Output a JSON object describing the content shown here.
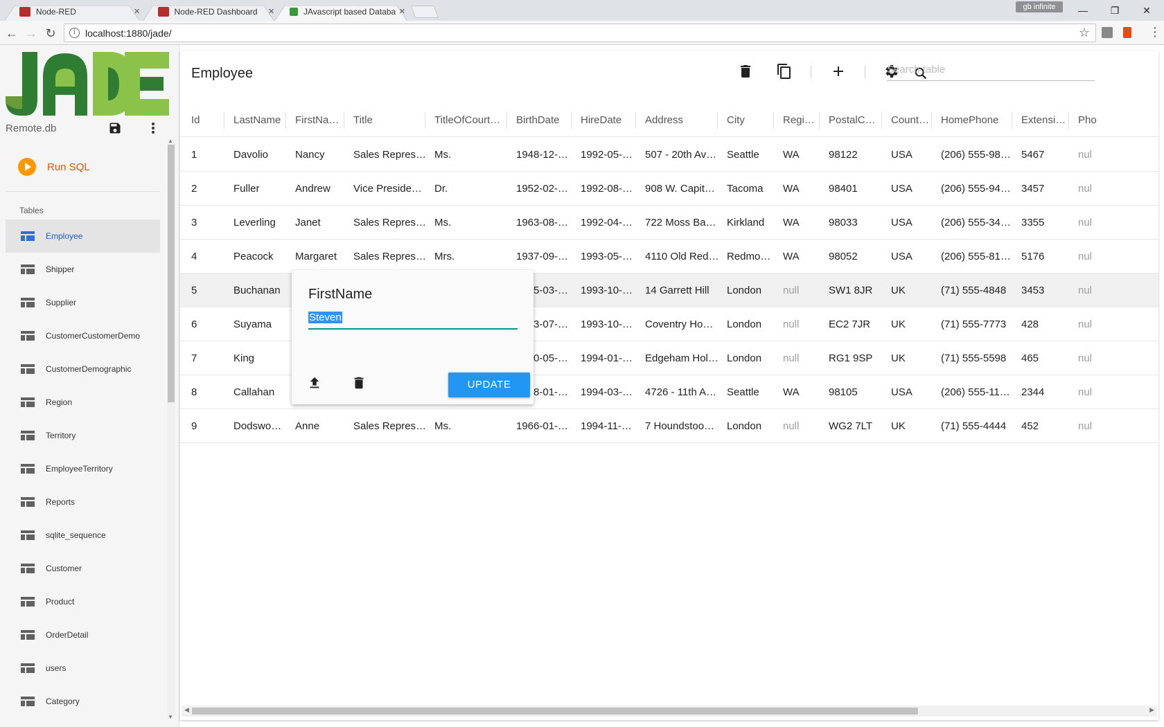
{
  "browser": {
    "tabs": [
      {
        "title": "Node-RED",
        "color": "#b52e2e"
      },
      {
        "title": "Node-RED Dashboard",
        "color": "#b52e2e"
      },
      {
        "title": "JAvascript based Databa",
        "color": "#3a9a3a"
      }
    ],
    "profile": "gb infinite",
    "url": "localhost:1880/jade/",
    "window_controls": {
      "minimize": "—",
      "restore": "❐",
      "close": "✕"
    }
  },
  "sidebar": {
    "db_name": "Remote.db",
    "run_sql": "Run SQL",
    "tables_header": "Tables",
    "tables": [
      "Employee",
      "Shipper",
      "Supplier",
      "CustomerCustomerDemo",
      "CustomerDemographic",
      "Region",
      "Territory",
      "EmployeeTerritory",
      "Reports",
      "sqlite_sequence",
      "Customer",
      "Product",
      "OrderDetail",
      "users",
      "Category"
    ],
    "selected_index": 0
  },
  "main": {
    "table_title": "Employee",
    "search_placeholder": "Search table",
    "columns": [
      "Id",
      "LastName",
      "FirstNa…",
      "Title",
      "TitleOfCourt…",
      "BirthDate",
      "HireDate",
      "Address",
      "City",
      "Regi…",
      "PostalC…",
      "Count…",
      "HomePhone",
      "Extensi…",
      "Pho"
    ],
    "rows": [
      [
        "1",
        "Davolio",
        "Nancy",
        "Sales Repres…",
        "Ms.",
        "1948-12-…",
        "1992-05-…",
        "507 - 20th Av…",
        "Seattle",
        "WA",
        "98122",
        "USA",
        "(206) 555-98…",
        "5467",
        "nul"
      ],
      [
        "2",
        "Fuller",
        "Andrew",
        "Vice Preside…",
        "Dr.",
        "1952-02-…",
        "1992-08-…",
        "908 W. Capit…",
        "Tacoma",
        "WA",
        "98401",
        "USA",
        "(206) 555-94…",
        "3457",
        "nul"
      ],
      [
        "3",
        "Leverling",
        "Janet",
        "Sales Repres…",
        "Ms.",
        "1963-08-…",
        "1992-04-…",
        "722 Moss Ba…",
        "Kirkland",
        "WA",
        "98033",
        "USA",
        "(206) 555-34…",
        "3355",
        "nul"
      ],
      [
        "4",
        "Peacock",
        "Margaret",
        "Sales Repres…",
        "Mrs.",
        "1937-09-…",
        "1993-05-…",
        "4110 Old Red…",
        "Redmo…",
        "WA",
        "98052",
        "USA",
        "(206) 555-81…",
        "5176",
        "nul"
      ],
      [
        "5",
        "Buchanan",
        "",
        "",
        "",
        "1955-03-…",
        "1993-10-…",
        "14 Garrett Hill",
        "London",
        "null",
        "SW1 8JR",
        "UK",
        "(71) 555-4848",
        "3453",
        "nul"
      ],
      [
        "6",
        "Suyama",
        "",
        "",
        "",
        "1963-07-…",
        "1993-10-…",
        "Coventry Ho…",
        "London",
        "null",
        "EC2 7JR",
        "UK",
        "(71) 555-7773",
        "428",
        "nul"
      ],
      [
        "7",
        "King",
        "",
        "",
        "",
        "1960-05-…",
        "1994-01-…",
        "Edgeham Hol…",
        "London",
        "null",
        "RG1 9SP",
        "UK",
        "(71) 555-5598",
        "465",
        "nul"
      ],
      [
        "8",
        "Callahan",
        "",
        "",
        "",
        "1958-01-…",
        "1994-03-…",
        "4726 - 11th A…",
        "Seattle",
        "WA",
        "98105",
        "USA",
        "(206) 555-11…",
        "2344",
        "nul"
      ],
      [
        "9",
        "Dodswo…",
        "Anne",
        "Sales Repres…",
        "Ms.",
        "1966-01-…",
        "1994-11-…",
        "7 Houndstoo…",
        "London",
        "null",
        "WG2 7LT",
        "UK",
        "(71) 555-4444",
        "452",
        "nul"
      ]
    ],
    "highlighted_row": 4
  },
  "editor": {
    "label": "FirstName",
    "value": "Steven",
    "update_label": "UPDATE"
  },
  "colors": {
    "accent_blue": "#2196f3",
    "run_sql_orange": "#ff9800",
    "logo_dark_green": "#2e7d32",
    "logo_light_green": "#8bc34a",
    "field_underline": "#009688"
  }
}
